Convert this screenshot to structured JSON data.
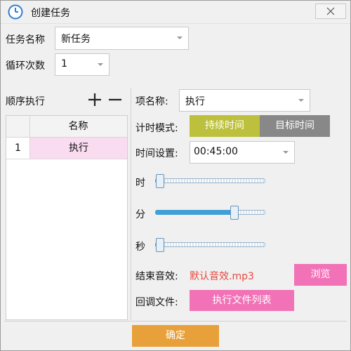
{
  "window": {
    "title": "创建任务",
    "close_icon": "close-icon"
  },
  "task": {
    "name_label": "任务名称",
    "name_value": "新任务",
    "loop_label": "循环次数",
    "loop_value": "1"
  },
  "sequence": {
    "label": "顺序执行",
    "add_icon": "plus-icon",
    "remove_icon": "minus-icon",
    "columns": [
      "",
      "名称"
    ],
    "rows": [
      {
        "index": "1",
        "name": "执行"
      }
    ]
  },
  "item": {
    "name_label": "项名称:",
    "name_value": "执行",
    "timer_mode_label": "计时模式:",
    "modes": [
      {
        "label": "持续时间",
        "active": true
      },
      {
        "label": "目标时间",
        "active": false
      }
    ],
    "time_label": "时间设置:",
    "time_value": "00:45:00",
    "sliders": [
      {
        "label": "时",
        "value_fraction": 0.0
      },
      {
        "label": "分",
        "value_fraction": 0.75
      },
      {
        "label": "秒",
        "value_fraction": 0.0
      }
    ],
    "end_sound_label": "结束音效:",
    "end_sound_value": "默认音效.mp3",
    "browse_label": "浏览",
    "callback_label": "回调文件:",
    "callback_button": "执行文件列表"
  },
  "footer": {
    "ok_label": "确定"
  },
  "colors": {
    "mode_active": "#bcc03c",
    "mode_inactive": "#888888",
    "sound_text": "#e8493f",
    "accent_pink": "#f272b8",
    "ok_button": "#e8a03a",
    "row_selected": "#fadcf0"
  }
}
